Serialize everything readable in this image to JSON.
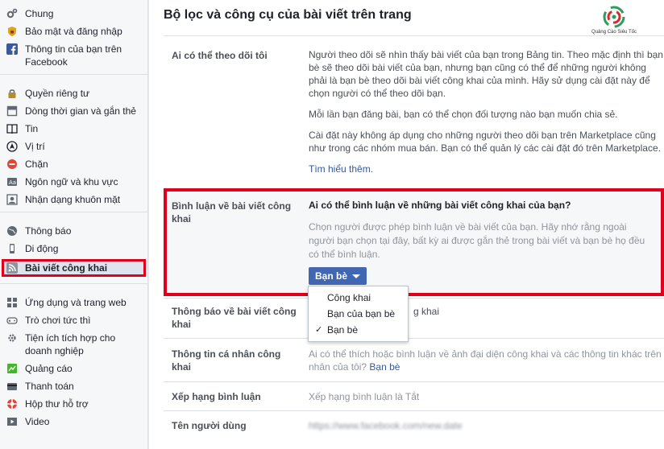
{
  "sidebar": {
    "groups": [
      [
        {
          "label": "Chung",
          "icon": "gears-icon"
        },
        {
          "label": "Bảo mật và đăng nhập",
          "icon": "shield-icon"
        },
        {
          "label": "Thông tin của bạn trên Facebook",
          "icon": "facebook-icon"
        }
      ],
      [
        {
          "label": "Quyền riêng tư",
          "icon": "lock-icon"
        },
        {
          "label": "Dòng thời gian và gắn thẻ",
          "icon": "timeline-icon"
        },
        {
          "label": "Tin",
          "icon": "book-icon"
        },
        {
          "label": "Vị trí",
          "icon": "location-icon"
        },
        {
          "label": "Chặn",
          "icon": "block-icon"
        },
        {
          "label": "Ngôn ngữ và khu vực",
          "icon": "language-icon"
        },
        {
          "label": "Nhận dạng khuôn mặt",
          "icon": "face-recognition-icon"
        }
      ],
      [
        {
          "label": "Thông báo",
          "icon": "globe-icon"
        },
        {
          "label": "Di động",
          "icon": "mobile-icon"
        },
        {
          "label": "Bài viết công khai",
          "icon": "rss-icon"
        }
      ],
      [
        {
          "label": "Ứng dụng và trang web",
          "icon": "apps-icon"
        },
        {
          "label": "Trò chơi tức thì",
          "icon": "gamepad-icon"
        },
        {
          "label": "Tiện ích tích hợp cho doanh nghiệp",
          "icon": "business-gear-icon"
        },
        {
          "label": "Quảng cáo",
          "icon": "ads-icon"
        },
        {
          "label": "Thanh toán",
          "icon": "card-icon"
        },
        {
          "label": "Hộp thư hỗ trợ",
          "icon": "lifebuoy-icon"
        },
        {
          "label": "Video",
          "icon": "video-icon"
        }
      ]
    ]
  },
  "main": {
    "title": "Bộ lọc và công cụ của bài viết trên trang",
    "logo_caption": "Quảng Cáo Siêu Tốc",
    "followers": {
      "label": "Ai có thể theo dõi tôi",
      "p1": "Người theo dõi sẽ nhìn thấy bài viết của bạn trong Bảng tin. Theo mặc định thì bạn bè sẽ theo dõi bài viết của bạn, nhưng bạn cũng có thể để những người không phải là bạn bè theo dõi bài viết công khai của mình. Hãy sử dụng cài đặt này để chọn người có thể theo dõi bạn.",
      "p2": "Mỗi lần bạn đăng bài, bạn có thể chọn đối tượng nào bạn muốn chia sẻ.",
      "p3": "Cài đặt này không áp dụng cho những người theo dõi bạn trên Marketplace cũng như trong các nhóm mua bán. Bạn có thể quản lý các cài đặt đó trên Marketplace.",
      "learn_more": "Tìm hiểu thêm."
    },
    "comments": {
      "label": "Bình luận về bài viết công khai",
      "question": "Ai có thể bình luận về những bài viết công khai của bạn?",
      "help": "Chọn người được phép bình luận về bài viết của bạn. Hãy nhớ rằng ngoài người bạn chọn tại đây, bất kỳ ai được gắn thẻ trong bài viết và bạn bè họ đều có thể bình luận.",
      "button_label": "Bạn bè",
      "options": [
        {
          "label": "Công khai",
          "selected": false
        },
        {
          "label": "Bạn của bạn bè",
          "selected": false
        },
        {
          "label": "Bạn bè",
          "selected": true
        }
      ],
      "check_mark": "✓"
    },
    "notifications": {
      "label": "Thông báo về bài viết công khai",
      "value_partial": "g khai"
    },
    "profile_info": {
      "label": "Thông tin cá nhân công khai",
      "value": "Ai có thể thích hoặc bình luận về ảnh đại diện công khai và các thông tin khác trên",
      "value2_prefix": "nhân của tôi?",
      "value2_link": "Bạn bè"
    },
    "comment_ranking": {
      "label": "Xếp hạng bình luận",
      "value": "Xếp hạng bình luận là Tắt"
    },
    "username": {
      "label": "Tên người dùng",
      "value": "https://www.facebook.com/new.date"
    }
  },
  "colors": {
    "accent": "#4267b2",
    "highlight_border": "#e0001b",
    "link": "#365899"
  }
}
